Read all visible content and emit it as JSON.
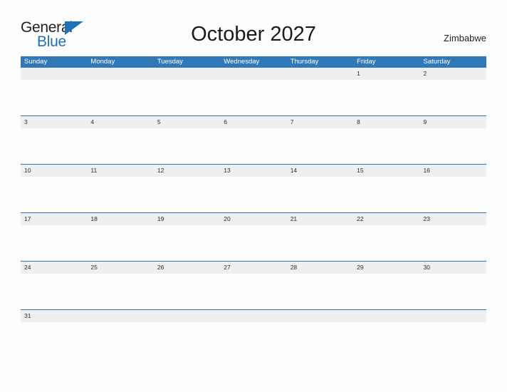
{
  "brand": {
    "name_part1": "General",
    "name_part2": "Blue",
    "triangle_icon": "triangle-icon",
    "accent_color": "#1e72b8"
  },
  "header": {
    "title": "October 2027",
    "country": "Zimbabwe"
  },
  "colors": {
    "header_blue": "#3078b8",
    "separator_blue": "#2e74b5",
    "date_band_gray": "#efeff0",
    "page_background": "#fdfdfd",
    "text_dark": "#231f20"
  },
  "calendar": {
    "month": "October",
    "year": "2027",
    "weekday_headers": [
      "Sunday",
      "Monday",
      "Tuesday",
      "Wednesday",
      "Thursday",
      "Friday",
      "Saturday"
    ],
    "weeks": [
      [
        "",
        "",
        "",
        "",
        "",
        "1",
        "2"
      ],
      [
        "3",
        "4",
        "5",
        "6",
        "7",
        "8",
        "9"
      ],
      [
        "10",
        "11",
        "12",
        "13",
        "14",
        "15",
        "16"
      ],
      [
        "17",
        "18",
        "19",
        "20",
        "21",
        "22",
        "23"
      ],
      [
        "24",
        "25",
        "26",
        "27",
        "28",
        "29",
        "30"
      ],
      [
        "31",
        "",
        "",
        "",
        "",
        "",
        ""
      ]
    ]
  }
}
